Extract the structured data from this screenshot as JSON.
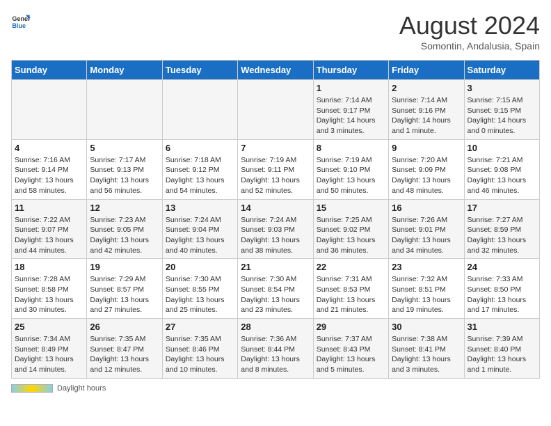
{
  "logo": {
    "line1": "General",
    "line2": "Blue"
  },
  "title": "August 2024",
  "subtitle": "Somontin, Andalusia, Spain",
  "weekdays": [
    "Sunday",
    "Monday",
    "Tuesday",
    "Wednesday",
    "Thursday",
    "Friday",
    "Saturday"
  ],
  "footer_label": "Daylight hours",
  "weeks": [
    [
      {
        "day": "",
        "info": ""
      },
      {
        "day": "",
        "info": ""
      },
      {
        "day": "",
        "info": ""
      },
      {
        "day": "",
        "info": ""
      },
      {
        "day": "1",
        "info": "Sunrise: 7:14 AM\nSunset: 9:17 PM\nDaylight: 14 hours\nand 3 minutes."
      },
      {
        "day": "2",
        "info": "Sunrise: 7:14 AM\nSunset: 9:16 PM\nDaylight: 14 hours\nand 1 minute."
      },
      {
        "day": "3",
        "info": "Sunrise: 7:15 AM\nSunset: 9:15 PM\nDaylight: 14 hours\nand 0 minutes."
      }
    ],
    [
      {
        "day": "4",
        "info": "Sunrise: 7:16 AM\nSunset: 9:14 PM\nDaylight: 13 hours\nand 58 minutes."
      },
      {
        "day": "5",
        "info": "Sunrise: 7:17 AM\nSunset: 9:13 PM\nDaylight: 13 hours\nand 56 minutes."
      },
      {
        "day": "6",
        "info": "Sunrise: 7:18 AM\nSunset: 9:12 PM\nDaylight: 13 hours\nand 54 minutes."
      },
      {
        "day": "7",
        "info": "Sunrise: 7:19 AM\nSunset: 9:11 PM\nDaylight: 13 hours\nand 52 minutes."
      },
      {
        "day": "8",
        "info": "Sunrise: 7:19 AM\nSunset: 9:10 PM\nDaylight: 13 hours\nand 50 minutes."
      },
      {
        "day": "9",
        "info": "Sunrise: 7:20 AM\nSunset: 9:09 PM\nDaylight: 13 hours\nand 48 minutes."
      },
      {
        "day": "10",
        "info": "Sunrise: 7:21 AM\nSunset: 9:08 PM\nDaylight: 13 hours\nand 46 minutes."
      }
    ],
    [
      {
        "day": "11",
        "info": "Sunrise: 7:22 AM\nSunset: 9:07 PM\nDaylight: 13 hours\nand 44 minutes."
      },
      {
        "day": "12",
        "info": "Sunrise: 7:23 AM\nSunset: 9:05 PM\nDaylight: 13 hours\nand 42 minutes."
      },
      {
        "day": "13",
        "info": "Sunrise: 7:24 AM\nSunset: 9:04 PM\nDaylight: 13 hours\nand 40 minutes."
      },
      {
        "day": "14",
        "info": "Sunrise: 7:24 AM\nSunset: 9:03 PM\nDaylight: 13 hours\nand 38 minutes."
      },
      {
        "day": "15",
        "info": "Sunrise: 7:25 AM\nSunset: 9:02 PM\nDaylight: 13 hours\nand 36 minutes."
      },
      {
        "day": "16",
        "info": "Sunrise: 7:26 AM\nSunset: 9:01 PM\nDaylight: 13 hours\nand 34 minutes."
      },
      {
        "day": "17",
        "info": "Sunrise: 7:27 AM\nSunset: 8:59 PM\nDaylight: 13 hours\nand 32 minutes."
      }
    ],
    [
      {
        "day": "18",
        "info": "Sunrise: 7:28 AM\nSunset: 8:58 PM\nDaylight: 13 hours\nand 30 minutes."
      },
      {
        "day": "19",
        "info": "Sunrise: 7:29 AM\nSunset: 8:57 PM\nDaylight: 13 hours\nand 27 minutes."
      },
      {
        "day": "20",
        "info": "Sunrise: 7:30 AM\nSunset: 8:55 PM\nDaylight: 13 hours\nand 25 minutes."
      },
      {
        "day": "21",
        "info": "Sunrise: 7:30 AM\nSunset: 8:54 PM\nDaylight: 13 hours\nand 23 minutes."
      },
      {
        "day": "22",
        "info": "Sunrise: 7:31 AM\nSunset: 8:53 PM\nDaylight: 13 hours\nand 21 minutes."
      },
      {
        "day": "23",
        "info": "Sunrise: 7:32 AM\nSunset: 8:51 PM\nDaylight: 13 hours\nand 19 minutes."
      },
      {
        "day": "24",
        "info": "Sunrise: 7:33 AM\nSunset: 8:50 PM\nDaylight: 13 hours\nand 17 minutes."
      }
    ],
    [
      {
        "day": "25",
        "info": "Sunrise: 7:34 AM\nSunset: 8:49 PM\nDaylight: 13 hours\nand 14 minutes."
      },
      {
        "day": "26",
        "info": "Sunrise: 7:35 AM\nSunset: 8:47 PM\nDaylight: 13 hours\nand 12 minutes."
      },
      {
        "day": "27",
        "info": "Sunrise: 7:35 AM\nSunset: 8:46 PM\nDaylight: 13 hours\nand 10 minutes."
      },
      {
        "day": "28",
        "info": "Sunrise: 7:36 AM\nSunset: 8:44 PM\nDaylight: 13 hours\nand 8 minutes."
      },
      {
        "day": "29",
        "info": "Sunrise: 7:37 AM\nSunset: 8:43 PM\nDaylight: 13 hours\nand 5 minutes."
      },
      {
        "day": "30",
        "info": "Sunrise: 7:38 AM\nSunset: 8:41 PM\nDaylight: 13 hours\nand 3 minutes."
      },
      {
        "day": "31",
        "info": "Sunrise: 7:39 AM\nSunset: 8:40 PM\nDaylight: 13 hours\nand 1 minute."
      }
    ]
  ]
}
